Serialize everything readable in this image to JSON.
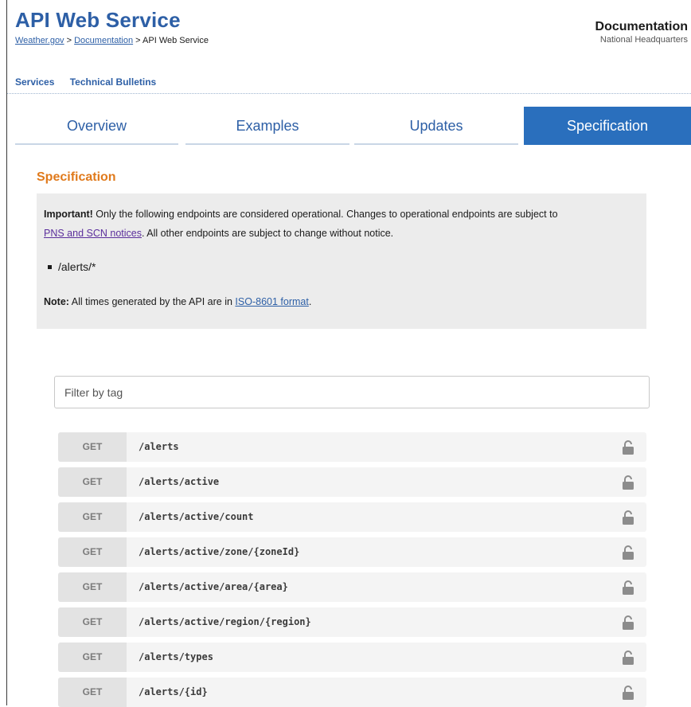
{
  "header": {
    "title": "API Web Service",
    "breadcrumb": {
      "home": "Weather.gov",
      "sep1": " > ",
      "docs": "Documentation",
      "sep2": " > ",
      "current": "API Web Service"
    },
    "doc_title": "Documentation",
    "doc_subtitle": "National Headquarters"
  },
  "subnav": {
    "services": "Services",
    "bulletins": "Technical Bulletins"
  },
  "tabs": [
    {
      "label": "Overview",
      "active": false
    },
    {
      "label": "Examples",
      "active": false
    },
    {
      "label": "Updates",
      "active": false
    },
    {
      "label": "Specification",
      "active": true
    }
  ],
  "spec": {
    "heading": "Specification",
    "important_label": "Important!",
    "important_text": " Only the following endpoints are considered operational. Changes to operational endpoints are subject to",
    "pns_link": "PNS and SCN notices",
    "after_link": ". All other endpoints are subject to change without notice.",
    "bullet": "/alerts/*",
    "note_label": "Note:",
    "note_text": " All times generated by the API are in ",
    "iso_link": "ISO-8601 format",
    "note_end": "."
  },
  "filter": {
    "placeholder": "Filter by tag"
  },
  "endpoints": [
    {
      "method": "GET",
      "path": "/alerts"
    },
    {
      "method": "GET",
      "path": "/alerts/active"
    },
    {
      "method": "GET",
      "path": "/alerts/active/count"
    },
    {
      "method": "GET",
      "path": "/alerts/active/zone/{zoneId}"
    },
    {
      "method": "GET",
      "path": "/alerts/active/area/{area}"
    },
    {
      "method": "GET",
      "path": "/alerts/active/region/{region}"
    },
    {
      "method": "GET",
      "path": "/alerts/types"
    },
    {
      "method": "GET",
      "path": "/alerts/{id}"
    }
  ],
  "colors": {
    "brand_blue": "#2d5fa6",
    "tab_active": "#2a6fbd",
    "heading_orange": "#e07a1c",
    "link_purple": "#5b2f9c"
  }
}
